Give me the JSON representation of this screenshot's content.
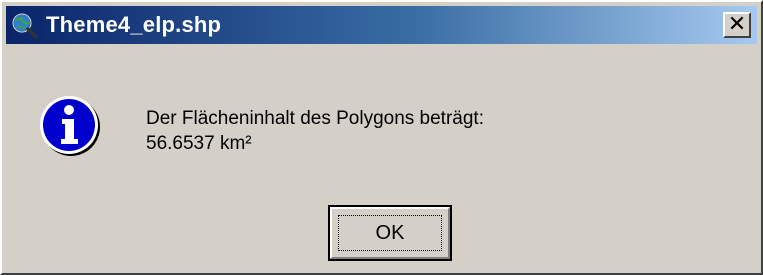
{
  "window": {
    "title": "Theme4_elp.shp",
    "app_icon": "globe-magnifier-icon",
    "close_icon": "close-icon"
  },
  "dialog": {
    "icon": "info-icon",
    "message_line1": "Der Flächeninhalt des Polygons beträgt:",
    "message_line2": "56.6537 km²",
    "ok_label": "OK"
  },
  "colors": {
    "titlebar_start": "#0a246a",
    "titlebar_end": "#a6caf0",
    "dialog_bg": "#d4d0c8",
    "info_blue": "#0000cc"
  }
}
